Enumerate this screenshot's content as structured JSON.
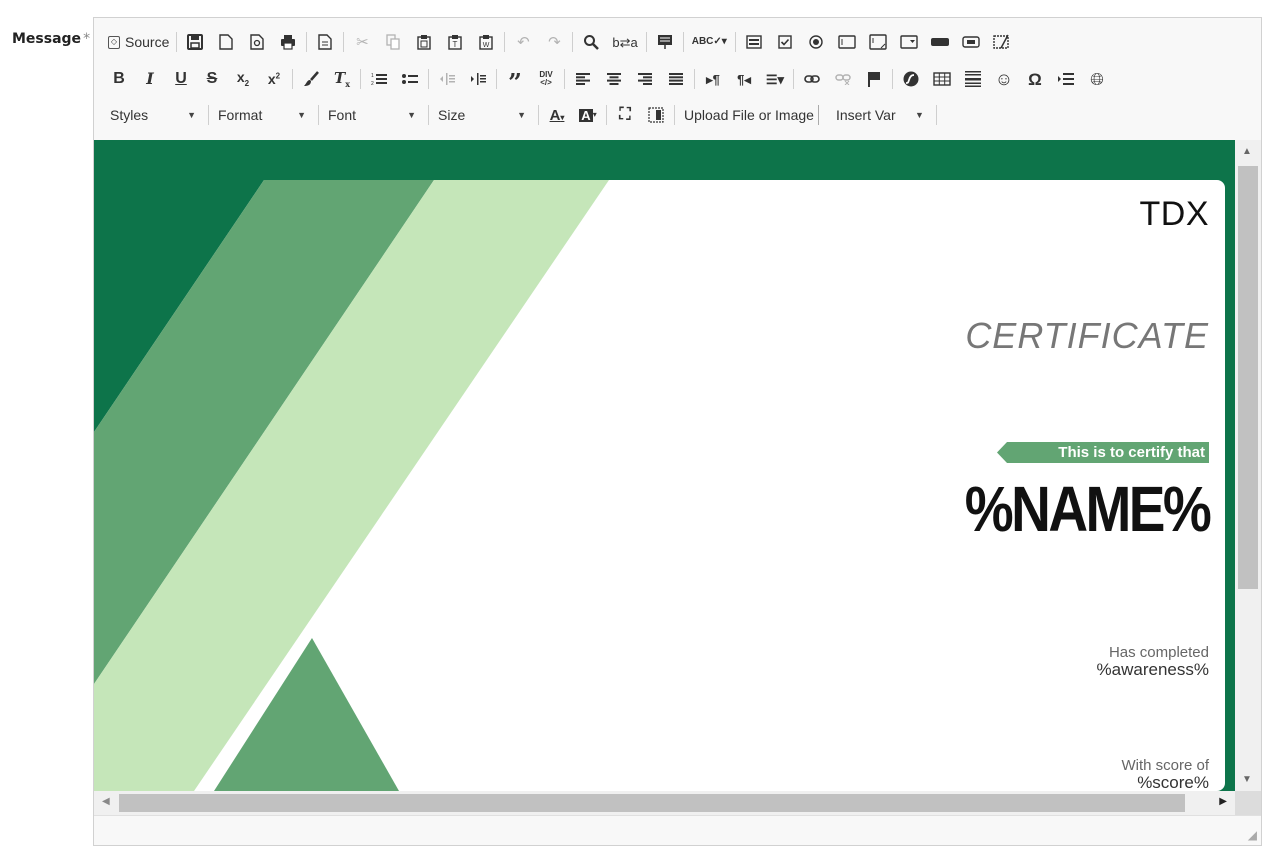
{
  "field": {
    "label": "Message",
    "required_mark": "*"
  },
  "toolbar": {
    "source_label": "Source",
    "styles_label": "Styles",
    "format_label": "Format",
    "font_label": "Font",
    "size_label": "Size",
    "upload_label": "Upload File or Image",
    "insert_var_label": "Insert Var",
    "div_label": "DIV"
  },
  "certificate": {
    "brand": "TDX",
    "title": "CERTIFICATE",
    "intro": "This is to certify that",
    "name": "%NAME%",
    "completed_label": "Has completed",
    "completed_value": "%awareness%",
    "score_label": "With score of",
    "score_value": "%score%",
    "colors": {
      "dark_green": "#0d744a",
      "mid_green": "#62a573",
      "light_green": "#c5e6b9"
    }
  }
}
